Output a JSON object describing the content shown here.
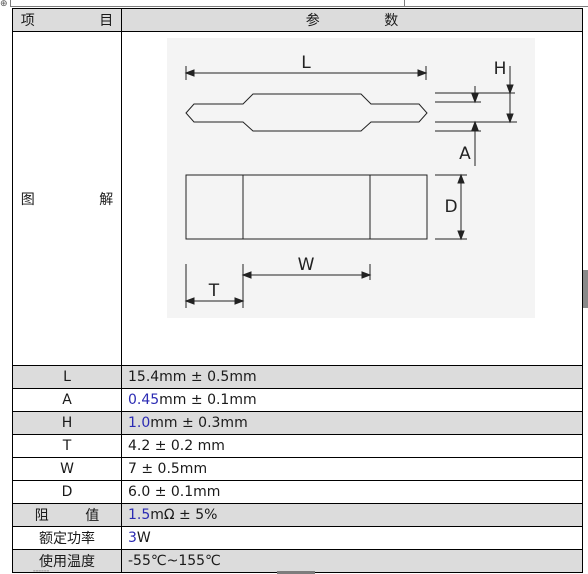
{
  "header": {
    "col_item": "项  目",
    "col_param": "参  数"
  },
  "diagram": {
    "row_label": "图  解",
    "dim_labels": {
      "L": "L",
      "H": "H",
      "A": "A",
      "D": "D",
      "W": "W",
      "T": "T"
    }
  },
  "params": [
    {
      "label": "L",
      "prefix": "",
      "value": "15.4mm ± 0.5mm",
      "shaded": true
    },
    {
      "label": "A",
      "prefix": "0.45",
      "value": "mm ± 0.1mm",
      "shaded": false
    },
    {
      "label": "H",
      "prefix": "1.0",
      "value": "mm ± 0.3mm",
      "shaded": true
    },
    {
      "label": "T",
      "prefix": "",
      "value": "4.2 ± 0.2 mm",
      "shaded": false
    },
    {
      "label": "W",
      "prefix": "",
      "value": "7 ± 0.5mm",
      "shaded": false
    },
    {
      "label": "D",
      "prefix": "",
      "value": "6.0 ± 0.1mm",
      "shaded": false
    },
    {
      "label": "阻  值",
      "prefix": "1.5",
      "value": "mΩ ± 5%",
      "shaded": true
    },
    {
      "label": "额定功率",
      "prefix": "3",
      "value": "W",
      "shaded": false
    },
    {
      "label": "使用温度",
      "prefix": "",
      "value": "-55℃~155℃",
      "shaded": true
    }
  ]
}
